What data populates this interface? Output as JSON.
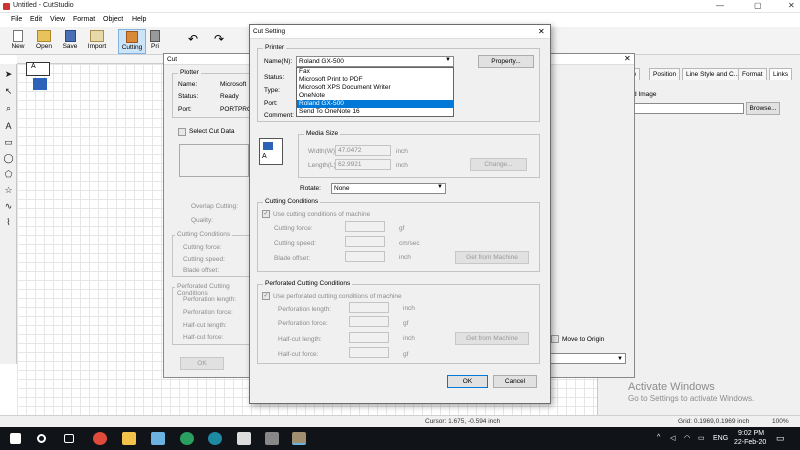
{
  "app": {
    "title": "Untitled - CutStudio"
  },
  "menu": [
    "File",
    "Edit",
    "View",
    "Format",
    "Object",
    "Help"
  ],
  "toolbar": [
    {
      "label": "New",
      "icon": "new-file-icon"
    },
    {
      "label": "Open",
      "icon": "folder-open-icon"
    },
    {
      "label": "Save",
      "icon": "save-icon"
    },
    {
      "label": "Import",
      "icon": "import-icon"
    },
    {
      "label": "Cutting",
      "icon": "cutting-icon",
      "active": true
    },
    {
      "label": "Pri",
      "icon": "print-icon"
    }
  ],
  "right_panel": {
    "tabs": [
      "pe",
      "Position",
      "Line Style and C...",
      "Format",
      "Links"
    ],
    "image_label": "d Image",
    "browse_label": "Browse...",
    "move_to_origin": "Move to Origin"
  },
  "cut_dialog_bg": {
    "title": "Cut",
    "plotter_group": "Plotter",
    "name_label": "Name:",
    "name_value": "Microsoft",
    "status_label": "Status:",
    "status_value": "Ready",
    "port_label": "Port:",
    "port_value": "PORTPRO",
    "select_cut_data": "Select Cut Data",
    "overlap_cutting": "Overlap Cutting:",
    "quality": "Quality:",
    "cutting_conditions": "Cutting Conditions",
    "cutting_force": "Cutting force:",
    "cutting_speed": "Cutting speed:",
    "blade_offset": "Blade offset:",
    "perf_conditions": "Perforated Cutting Conditions",
    "perf_length": "Perforation length:",
    "perf_force": "Perforation force:",
    "halfcut_length": "Half-cut length:",
    "halfcut_force": "Half-cut force:",
    "ok": "OK"
  },
  "cut_setting": {
    "title": "Cut Setting",
    "close_glyph": "✕",
    "printer_group": "Printer",
    "name_label": "Name(N):",
    "name_value": "Roland GX-500",
    "status_label": "Status:",
    "type_label": "Type:",
    "port_label": "Port:",
    "comment_label": "Comment:",
    "property_button": "Property...",
    "dropdown_options": [
      "Fax",
      "Microsoft Print to PDF",
      "Microsoft XPS Document Writer",
      "OneNote",
      "Roland GX-500",
      "Send To OneNote 16"
    ],
    "dropdown_selected": "Roland GX-500",
    "media_group": "Media Size",
    "width_label": "Width(W):",
    "width_value": "47.0472",
    "length_label": "Length(L):",
    "length_value": "62.9921",
    "unit": "inch",
    "change_button": "Change...",
    "rotate_label": "Rotate:",
    "rotate_value": "None",
    "cutting_group": "Cutting Conditions",
    "use_machine": "Use cutting conditions of machine",
    "cutting_force": "Cutting force:",
    "cutting_speed": "Cutting speed:",
    "blade_offset": "Blade offset:",
    "unit_gf": "gf",
    "unit_cms": "cm/sec",
    "get_from_machine": "Get from Machine",
    "perf_group": "Perforated Cutting Conditions",
    "use_perf_machine": "Use perforated cutting conditions of machine",
    "perf_length": "Perforation length:",
    "perf_force": "Perforation force:",
    "halfcut_length": "Half-cut length:",
    "halfcut_force": "Half-cut force:",
    "ok": "OK",
    "cancel": "Cancel"
  },
  "status_bar": {
    "cursor": "Cursor: 1.675, -0.594 inch",
    "grid": "Grid: 0.1969,0.1969 inch",
    "zoom": "100%"
  },
  "watermark": {
    "line1": "Activate Windows",
    "line2": "Go to Settings to activate Windows."
  },
  "taskbar": {
    "lang": "ENG",
    "time": "9:02 PM",
    "date": "22-Feb-20"
  }
}
